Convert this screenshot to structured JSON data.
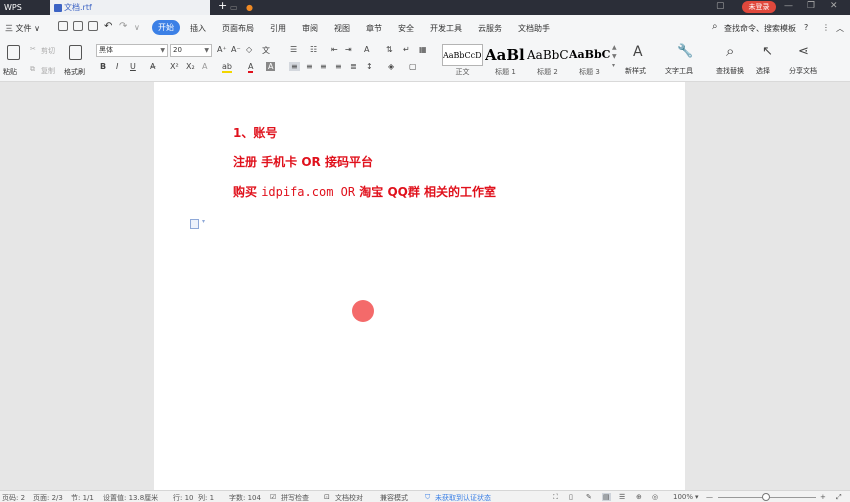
{
  "titlebar": {
    "app": "WPS",
    "tab_title": "文档.rtf",
    "new_tab": "+",
    "login": "未登录",
    "min": "—",
    "restore": "❐",
    "close": "✕"
  },
  "menubar": {
    "file": "三 文件 ∨",
    "tabs": [
      "开始",
      "插入",
      "页面布局",
      "引用",
      "审阅",
      "视图",
      "章节",
      "安全",
      "开发工具",
      "云服务",
      "文档助手"
    ],
    "search": "查找命令、搜索模板",
    "help": "?",
    "collapse": "︿"
  },
  "ribbon": {
    "paste": "粘贴",
    "cut": "剪切",
    "copy": "复制",
    "format_painter": "格式刷",
    "font_name": "黑体",
    "font_size": "20",
    "bold": "B",
    "italic": "I",
    "underline": "U",
    "styles": [
      {
        "preview": "AaBbCcDd",
        "label": "正文"
      },
      {
        "preview": "AaBl",
        "label": "标题 1"
      },
      {
        "preview": "AaBbC",
        "label": "标题 2"
      },
      {
        "preview": "AaBbC",
        "label": "标题 3"
      }
    ],
    "new_style": "新样式",
    "text_tools": "文字工具",
    "find_replace": "查找替换",
    "select": "选择",
    "share_doc": "分享文档"
  },
  "document": {
    "lines": [
      {
        "text": "1、账号"
      },
      {
        "text": "注册 手机卡 OR 接码平台"
      },
      {
        "prefix": "购买 ",
        "mono": "idpifa.com OR",
        "suffix": " 淘宝  QQ群  相关的工作室"
      }
    ],
    "text_color": "#e0111c"
  },
  "statusbar": {
    "page_no": "页码: 2",
    "pages": "页面: 2/3",
    "section": "节: 1/1",
    "setting": "设置值: 13.8厘米",
    "row": "行: 10",
    "col": "列: 1",
    "words": "字数: 104",
    "spell": "拼写检查",
    "proof": "文档校对",
    "compat": "兼容模式",
    "cert": "未获取到认证状态",
    "zoom": "100%",
    "zoom_out": "—",
    "zoom_in": "+"
  },
  "colors": {
    "accent": "#3c80e6",
    "titlebar": "#2b2e38",
    "login_badge": "#e0483c",
    "cursor_dot": "#f46a6a"
  }
}
